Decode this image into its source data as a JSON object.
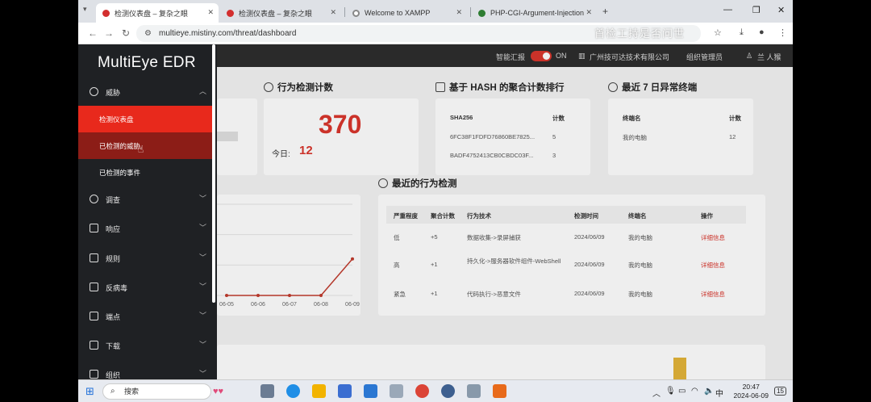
{
  "browser": {
    "tabs": [
      {
        "title": "检测仪表盘 – 复杂之眼",
        "active": true,
        "color": "#d32f2f"
      },
      {
        "title": "检测仪表盘 – 复杂之眼",
        "active": false,
        "color": "#d32f2f"
      },
      {
        "title": "Welcome to XAMPP",
        "active": false,
        "color": "#888888"
      },
      {
        "title": "PHP-CGI-Argument-Injection",
        "active": false,
        "color": "#2e7d32"
      }
    ],
    "url": "multieye.mistiny.com/threat/dashboard",
    "watermark": "首检工持是否问世"
  },
  "topnav": {
    "smart_report": "智能汇报",
    "toggle_state": "ON",
    "company": "广州技可达技术有限公司",
    "org_admin": "组织管理员",
    "user": "兰 人猴"
  },
  "sidebar": {
    "brand": "MultiEye EDR",
    "menu": [
      {
        "label": "威胁",
        "icon": "threat-icon",
        "expanded": true
      },
      {
        "label": "调查",
        "icon": "search-icon"
      },
      {
        "label": "响应",
        "icon": "response-icon"
      },
      {
        "label": "规则",
        "icon": "rules-icon"
      },
      {
        "label": "反病毒",
        "icon": "antivirus-icon"
      },
      {
        "label": "端点",
        "icon": "endpoint-icon"
      },
      {
        "label": "下载",
        "icon": "download-icon"
      },
      {
        "label": "组织",
        "icon": "org-icon"
      }
    ],
    "submenu": [
      {
        "label": "检测仪表盘",
        "state": "active"
      },
      {
        "label": "已检测的威胁",
        "state": "hover"
      },
      {
        "label": "已检测的事件",
        "state": "normal"
      }
    ]
  },
  "behavior_count": {
    "title": "行为检测计数",
    "total": "370",
    "today_label": "今日:",
    "today": "12"
  },
  "hash_rank": {
    "title": "基于 HASH 的聚合计数排行",
    "headers": [
      "SHA256",
      "计数"
    ],
    "rows": [
      [
        "6FC38F1FDFD76860BE7825...",
        "5"
      ],
      [
        "BADF4752413CB0CBDC03F...",
        "3"
      ]
    ]
  },
  "abnormal_endpoints": {
    "title": "最近 7 日异常终端",
    "headers": [
      "终端名",
      "计数"
    ],
    "rows": [
      [
        "我的电脑",
        "12"
      ]
    ]
  },
  "recent_detections": {
    "title": "最近的行为检测",
    "headers": [
      "严重程度",
      "聚合计数",
      "行为技术",
      "检测时间",
      "终端名",
      "操作"
    ],
    "rows": [
      {
        "severity": "低",
        "count": "+5",
        "tech": "数据收集->录屏捕获",
        "time": "2024/06/09",
        "endpoint": "我的电脑",
        "action": "详细信息"
      },
      {
        "severity": "高",
        "count": "+1",
        "tech": "持久化->服务器软件组件-WebShell",
        "time": "2024/06/09",
        "endpoint": "我的电脑",
        "action": "详细信息"
      },
      {
        "severity": "紧急",
        "count": "+1",
        "tech": "代码执行->恶意文件",
        "time": "2024/06/09",
        "endpoint": "我的电脑",
        "action": "详细信息"
      }
    ]
  },
  "chart_data": {
    "type": "line",
    "categories": [
      "06-05",
      "06-06",
      "06-07",
      "06-08",
      "06-09"
    ],
    "values": [
      0,
      0,
      0,
      0,
      12
    ],
    "ylim": [
      0,
      30
    ],
    "color": "#c0392b",
    "grid": true
  },
  "taskbar": {
    "search_label": "搜索",
    "time": "20:47",
    "date": "2024-06-09",
    "ime": "中",
    "notif": "15"
  }
}
